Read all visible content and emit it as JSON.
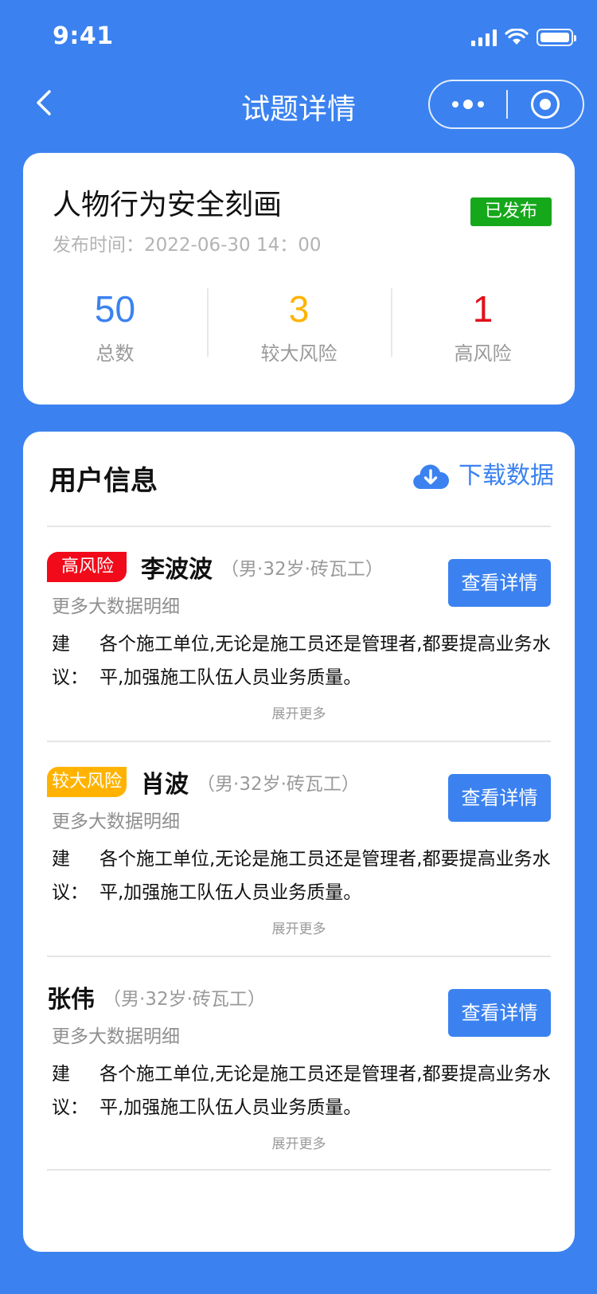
{
  "status_bar": {
    "time": "9:41",
    "icons": [
      "signal-icon",
      "wifi-icon",
      "battery-icon"
    ]
  },
  "nav": {
    "title": "试题详情",
    "back_icon": "chevron-left-icon",
    "more_icon": "more-dots-icon",
    "close_icon": "target-icon"
  },
  "summary": {
    "title": "人物行为安全刻画",
    "status": "已发布",
    "publish_time": "发布时间：2022-06-30 14：00",
    "stats": [
      {
        "value": "50",
        "label": "总数",
        "color": "#3B82F0"
      },
      {
        "value": "3",
        "label": "较大风险",
        "color": "#FFB300"
      },
      {
        "value": "1",
        "label": "高风险",
        "color": "#E0101C"
      }
    ]
  },
  "user_section": {
    "title": "用户信息",
    "download_label": "下载数据",
    "download_icon": "cloud-download-icon",
    "users": [
      {
        "risk_tag": "高风险",
        "risk_level": "high",
        "name": "李波波",
        "meta": "（男·32岁·砖瓦工）",
        "more_link": "更多大数据明细",
        "button_label": "查看详情",
        "suggest_label": "建议：",
        "suggest_text": "各个施工单位,无论是施工员还是管理者,都要提高业务水平,加强施工队伍人员业务质量。",
        "expand_label": "展开更多"
      },
      {
        "risk_tag": "较大风险",
        "risk_level": "mid",
        "name": "肖波",
        "meta": "（男·32岁·砖瓦工）",
        "more_link": "更多大数据明细",
        "button_label": "查看详情",
        "suggest_label": "建议：",
        "suggest_text": "各个施工单位,无论是施工员还是管理者,都要提高业务水平,加强施工队伍人员业务质量。",
        "expand_label": "展开更多"
      },
      {
        "risk_tag": "",
        "risk_level": "none",
        "name": "张伟",
        "meta": "（男·32岁·砖瓦工）",
        "more_link": "更多大数据明细",
        "button_label": "查看详情",
        "suggest_label": "建议：",
        "suggest_text": "各个施工单位,无论是施工员还是管理者,都要提高业务水平,加强施工队伍人员业务质量。",
        "expand_label": "展开更多"
      }
    ]
  }
}
